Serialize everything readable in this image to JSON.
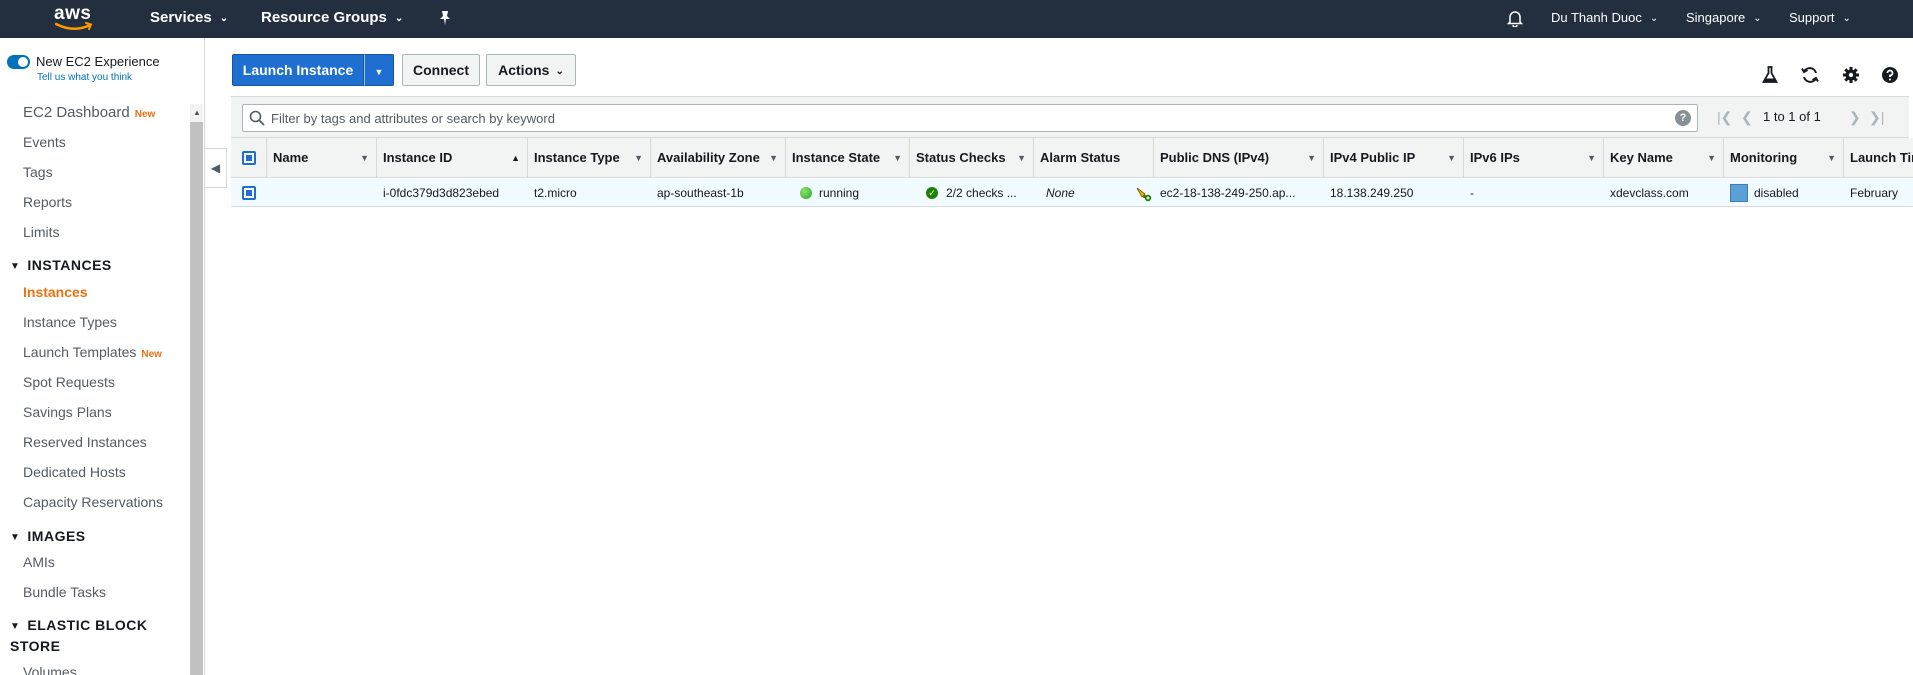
{
  "topnav": {
    "logo": "aws",
    "services": "Services",
    "resource_groups": "Resource Groups",
    "user": "Du Thanh Duoc",
    "region": "Singapore",
    "support": "Support"
  },
  "sidebar": {
    "toggle_label": "New EC2 Experience",
    "toggle_sub": "Tell us what you think",
    "new_badge": "New",
    "items": {
      "dashboard": "EC2 Dashboard",
      "events": "Events",
      "tags": "Tags",
      "reports": "Reports",
      "limits": "Limits",
      "instances": "Instances",
      "instance_types": "Instance Types",
      "launch_templates": "Launch Templates",
      "spot_requests": "Spot Requests",
      "savings_plans": "Savings Plans",
      "reserved_instances": "Reserved Instances",
      "dedicated_hosts": "Dedicated Hosts",
      "capacity_reservations": "Capacity Reservations",
      "amis": "AMIs",
      "bundle_tasks": "Bundle Tasks",
      "volumes": "Volumes"
    },
    "sections": {
      "instances": "INSTANCES",
      "images": "IMAGES",
      "ebs": "ELASTIC BLOCK STORE"
    }
  },
  "toolbar": {
    "launch_instance": "Launch Instance",
    "connect": "Connect",
    "actions": "Actions"
  },
  "filter": {
    "placeholder": "Filter by tags and attributes or search by keyword",
    "pagination": "1 to 1 of 1"
  },
  "table": {
    "columns": {
      "name": "Name",
      "instance_id": "Instance ID",
      "instance_type": "Instance Type",
      "az": "Availability Zone",
      "state": "Instance State",
      "status_checks": "Status Checks",
      "alarm_status": "Alarm Status",
      "public_dns": "Public DNS (IPv4)",
      "ipv4": "IPv4 Public IP",
      "ipv6": "IPv6 IPs",
      "key_name": "Key Name",
      "monitoring": "Monitoring",
      "launch_time": "Launch Time"
    },
    "row": {
      "name": "",
      "instance_id": "i-0fdc379d3d823ebed",
      "instance_type": "t2.micro",
      "az": "ap-southeast-1b",
      "state": "running",
      "status_checks": "2/2 checks ...",
      "alarm_status": "None",
      "public_dns": "ec2-18-138-249-250.ap...",
      "ipv4": "18.138.249.250",
      "ipv6": "-",
      "key_name": "xdevclass.com",
      "monitoring": "disabled",
      "launch_time": "February"
    }
  },
  "colors": {
    "nav_bg": "#232f3e",
    "primary": "#1f6fd1",
    "accent_orange": "#ec7211",
    "row_selected": "#f1faff",
    "running": "#29a329"
  }
}
